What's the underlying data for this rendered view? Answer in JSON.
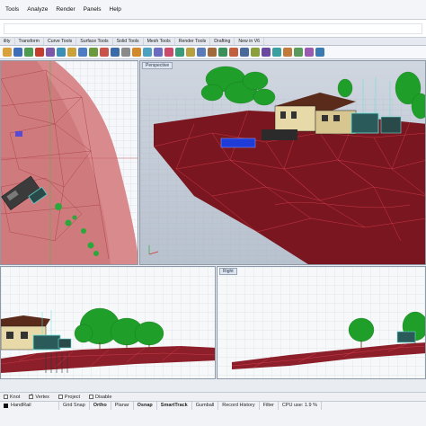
{
  "menu": [
    "Tools",
    "Analyze",
    "Render",
    "Panels",
    "Help"
  ],
  "toolbar_tabs": [
    {
      "label": "ility",
      "active": false
    },
    {
      "label": "Transform",
      "active": false
    },
    {
      "label": "Curve Tools",
      "active": false
    },
    {
      "label": "Surface Tools",
      "active": false
    },
    {
      "label": "Solid Tools",
      "active": false
    },
    {
      "label": "Mesh Tools",
      "active": false
    },
    {
      "label": "Render Tools",
      "active": false
    },
    {
      "label": "Drafting",
      "active": false
    },
    {
      "label": "New in V6",
      "active": false
    }
  ],
  "toolbar_icons": [
    "#d9a13a",
    "#3d6fb8",
    "#4d9b50",
    "#c33b2c",
    "#7c57a8",
    "#3b8fb5",
    "#c9a23a",
    "#4b7cc4",
    "#6a9a3d",
    "#c9534a",
    "#3a6aa8",
    "#8a8a8a",
    "#d18a2a",
    "#4da0c0",
    "#6b6bc0",
    "#c94a6a",
    "#3a9a7a",
    "#b8a040",
    "#5a7ab8",
    "#a06a3a",
    "#3b8f5a",
    "#c06040",
    "#4a6a9a",
    "#8aa03a",
    "#6a4aa0",
    "#3aa0a0",
    "#c07a3a",
    "#5a9a5a",
    "#9a5ab0",
    "#3a7ab0"
  ],
  "viewports": {
    "top_left": {
      "label": ""
    },
    "perspective": {
      "label": "Perspective"
    },
    "front": {
      "label": ""
    },
    "right": {
      "label": "Right"
    }
  },
  "osnap": [
    {
      "label": "Knot",
      "checked": false
    },
    {
      "label": "Vertex",
      "checked": true
    },
    {
      "label": "Project",
      "checked": false
    },
    {
      "label": "Disable",
      "checked": false
    }
  ],
  "status": {
    "layer": "HandRail",
    "grid_snap": "Grid Snap",
    "ortho": "Ortho",
    "planar": "Planar",
    "osnap": "Osnap",
    "smarttrack": "SmartTrack",
    "gumball": "Gumball",
    "record_history": "Record History",
    "filter": "Filter",
    "cpu": "CPU use: 1.9 %"
  },
  "colors": {
    "terrain": "#8c1f2a",
    "terrain_pink": "#d98a8c",
    "mesh_line": "#e04050",
    "trees": "#1f9e2a",
    "selection_blue": "#1f3cd8"
  }
}
